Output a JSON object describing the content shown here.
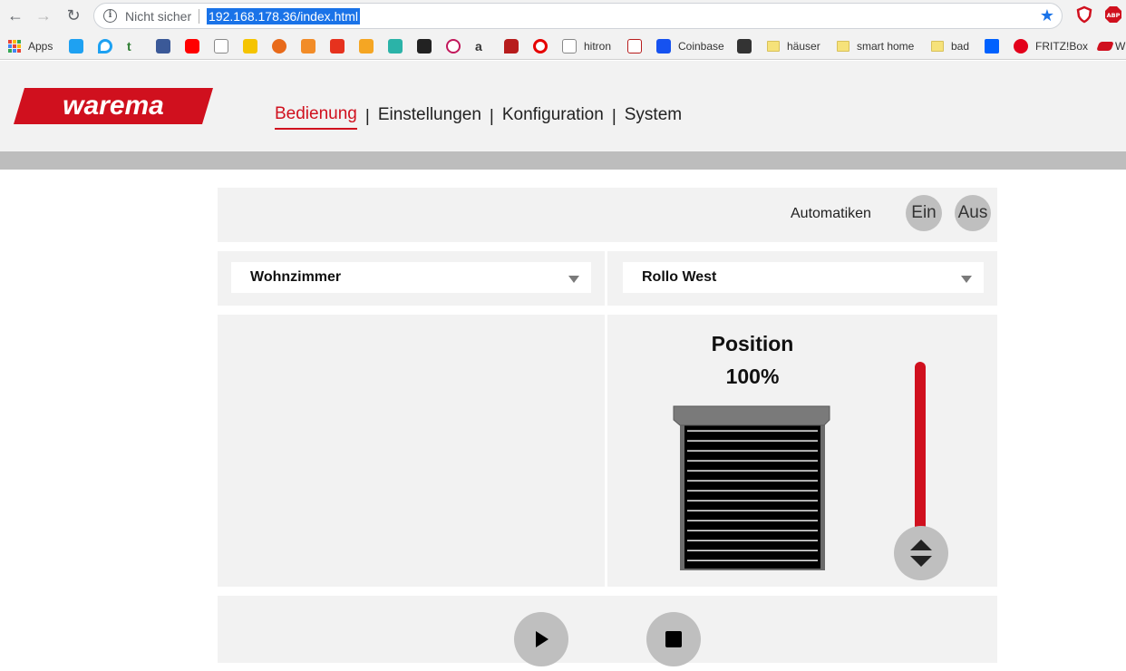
{
  "browser": {
    "insecure_label": "Nicht sicher",
    "url": "192.168.178.36/index.html",
    "bookmarks": [
      {
        "label": "Apps"
      },
      {
        "label": "hitron"
      },
      {
        "label": "Coinbase"
      },
      {
        "label": "häuser"
      },
      {
        "label": "smart home"
      },
      {
        "label": "bad"
      },
      {
        "label": "FRITZ!Box"
      },
      {
        "label": "W"
      }
    ]
  },
  "header": {
    "logo_text": "warema",
    "nav": [
      {
        "label": "Bedienung",
        "active": true
      },
      {
        "label": "Einstellungen"
      },
      {
        "label": "Konfiguration"
      },
      {
        "label": "System"
      }
    ]
  },
  "automatics": {
    "label": "Automatiken",
    "on_label": "Ein",
    "off_label": "Aus"
  },
  "selectors": {
    "room": "Wohnzimmer",
    "device": "Rollo West"
  },
  "position": {
    "title": "Position",
    "value": "100%",
    "level": 1.0
  },
  "colors": {
    "brand_red": "#d0101e",
    "panel_bg": "#f2f2f2",
    "button_grey": "#bfbfbf"
  },
  "icons": {
    "play": "play-icon",
    "stop": "stop-icon",
    "slider": "up-down-arrows-icon"
  }
}
